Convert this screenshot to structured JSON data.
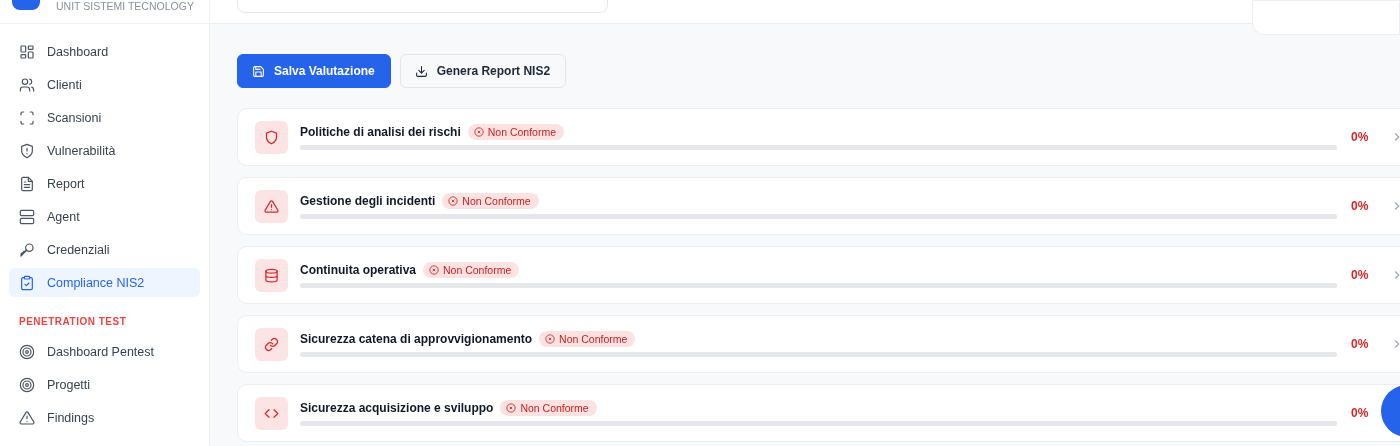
{
  "brand": {
    "subtitle": "UNIT SISTEMI TECNOLOGY"
  },
  "sidebar": {
    "items": [
      {
        "label": "Dashboard",
        "selected": false
      },
      {
        "label": "Clienti",
        "selected": false
      },
      {
        "label": "Scansioni",
        "selected": false
      },
      {
        "label": "Vulnerabilità",
        "selected": false
      },
      {
        "label": "Report",
        "selected": false
      },
      {
        "label": "Agent",
        "selected": false
      },
      {
        "label": "Credenziali",
        "selected": false
      },
      {
        "label": "Compliance NIS2",
        "selected": true
      }
    ],
    "section": "PENETRATION TEST",
    "section_items": [
      {
        "label": "Dashboard Pentest",
        "selected": false
      },
      {
        "label": "Progetti",
        "selected": false
      },
      {
        "label": "Findings",
        "selected": false
      }
    ]
  },
  "actions": [
    {
      "label": "Salva Valutazione",
      "kind": "primary"
    },
    {
      "label": "Genera Report NIS2",
      "kind": "secondary"
    }
  ],
  "requirements": [
    {
      "title": "Politiche di analisi dei rischi",
      "status": "Non Conforme",
      "level": 0,
      "percent": "0%"
    },
    {
      "title": "Gestione degli incidenti",
      "status": "Non Conforme",
      "level": 0,
      "percent": "0%"
    },
    {
      "title": "Continuita operativa",
      "status": "Non Conforme",
      "level": 0,
      "percent": "0%"
    },
    {
      "title": "Sicurezza catena di approvvigionamento",
      "status": "Non Conforme",
      "level": 0,
      "percent": "0%"
    },
    {
      "title": "Sicurezza acquisizione e sviluppo",
      "status": "Non Conforme",
      "level": 0,
      "percent": "0%"
    }
  ]
}
